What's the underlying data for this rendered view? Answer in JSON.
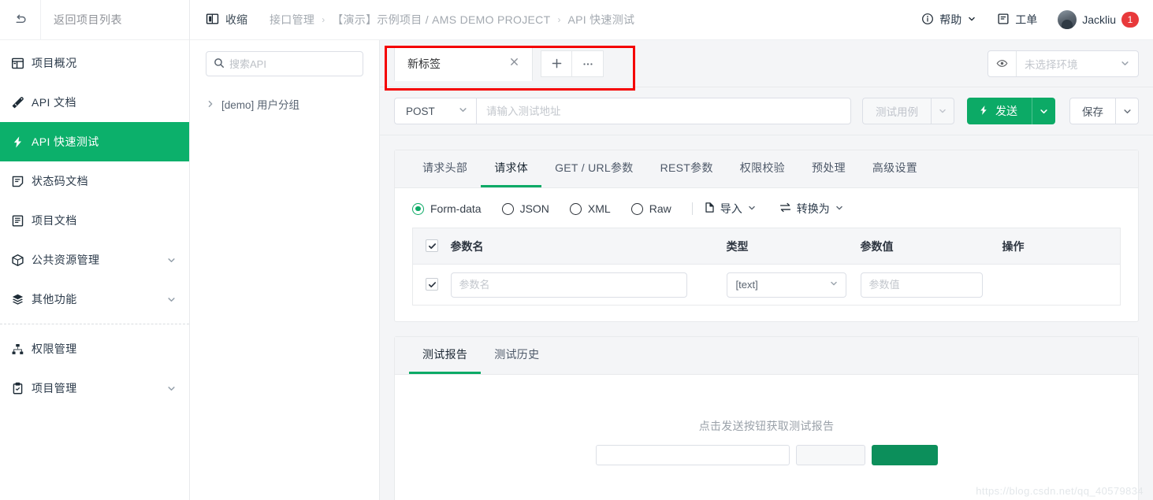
{
  "sidebar": {
    "back_label": "返回项目列表",
    "back_icon": "undo-arrow-icon",
    "items": [
      {
        "label": "项目概况",
        "icon": "dashboard-icon",
        "has_arrow": false,
        "active": false
      },
      {
        "label": "API 文档",
        "icon": "doc-pen-icon",
        "has_arrow": false,
        "active": false
      },
      {
        "label": "API 快速测试",
        "icon": "lightning-icon",
        "has_arrow": false,
        "active": true
      },
      {
        "label": "状态码文档",
        "icon": "status-doc-icon",
        "has_arrow": false,
        "active": false
      },
      {
        "label": "项目文档",
        "icon": "book-icon",
        "has_arrow": false,
        "active": false
      },
      {
        "label": "公共资源管理",
        "icon": "box-icon",
        "has_arrow": true,
        "active": false
      },
      {
        "label": "其他功能",
        "icon": "layers-icon",
        "has_arrow": true,
        "active": false
      },
      {
        "label": "权限管理",
        "icon": "sitemap-icon",
        "has_arrow": false,
        "active": false
      },
      {
        "label": "项目管理",
        "icon": "clipboard-icon",
        "has_arrow": true,
        "active": false
      }
    ],
    "separator_after_index": 6
  },
  "topbar": {
    "collapse_label": "收缩",
    "collapse_icon": "panel-collapse-icon",
    "breadcrumb": [
      "接口管理",
      "【演示】示例项目 / AMS DEMO PROJECT",
      "API 快速测试"
    ],
    "breadcrumb_sep": "›",
    "help_label": "帮助",
    "help_icon": "info-circle-icon",
    "help_arrow_icon": "chevron-down-icon",
    "ticket_label": "工单",
    "ticket_icon": "ticket-doc-icon",
    "user_name": "Jackliu",
    "user_avatar_icon": "avatar",
    "notification_count": "1"
  },
  "api_panel": {
    "search_placeholder": "搜索API",
    "search_value": "",
    "search_icon": "search-icon",
    "tree": [
      {
        "label": "[demo] 用户分组",
        "caret_icon": "chevron-right-icon",
        "expanded": false
      }
    ]
  },
  "tester": {
    "request_tabs": [
      {
        "label": "新标签",
        "close_icon": "close-icon",
        "active": true
      }
    ],
    "add_tab_label": "+",
    "more_tabs_label": "···",
    "env": {
      "eye_icon": "eye-icon",
      "placeholder": "未选择环境",
      "value": "",
      "arrow_icon": "chevron-down-icon"
    },
    "url_row": {
      "method": "POST",
      "method_arrow_icon": "chevron-down-icon",
      "url_placeholder": "请输入测试地址",
      "url_value": "",
      "testcase_label": "测试用例",
      "testcase_arrow_icon": "chevron-down-icon",
      "testcase_disabled": true,
      "send_label": "发送",
      "send_icon": "lightning-icon",
      "send_arrow_icon": "chevron-down-icon",
      "save_label": "保存",
      "save_arrow_icon": "chevron-down-icon"
    },
    "request_tabs_nav": [
      {
        "label": "请求头部",
        "active": false
      },
      {
        "label": "请求体",
        "active": true
      },
      {
        "label": "GET / URL参数",
        "active": false
      },
      {
        "label": "REST参数",
        "active": false
      },
      {
        "label": "权限校验",
        "active": false
      },
      {
        "label": "预处理",
        "active": false
      },
      {
        "label": "高级设置",
        "active": false
      }
    ],
    "body_types": [
      {
        "label": "Form-data",
        "selected": true
      },
      {
        "label": "JSON",
        "selected": false
      },
      {
        "label": "XML",
        "selected": false
      },
      {
        "label": "Raw",
        "selected": false
      }
    ],
    "import_label": "导入",
    "import_icon": "import-icon",
    "import_arrow_icon": "chevron-down-icon",
    "convert_label": "转换为",
    "convert_icon": "convert-icon",
    "convert_arrow_icon": "chevron-down-icon",
    "param_table": {
      "headers": [
        "参数名",
        "类型",
        "参数值",
        "操作"
      ],
      "header_checkbox_checked": true,
      "rows": [
        {
          "checked": true,
          "name_placeholder": "参数名",
          "name_value": "",
          "type_value": "[text]",
          "type_arrow_icon": "chevron-down-icon",
          "value_placeholder": "参数值",
          "value_value": "",
          "action": ""
        }
      ]
    },
    "result_tabs": [
      {
        "label": "测试报告",
        "active": true
      },
      {
        "label": "测试历史",
        "active": false
      }
    ],
    "empty_hint": "点击发送按钮获取测试报告",
    "empty_controls": {
      "input_value": "",
      "gray_button_label": "",
      "green_button_label": ""
    }
  },
  "annotation": {
    "highlight_color": "#f40000",
    "target": "新标签 tab group"
  },
  "watermark": "https://blog.csdn.net/qq_40579834"
}
